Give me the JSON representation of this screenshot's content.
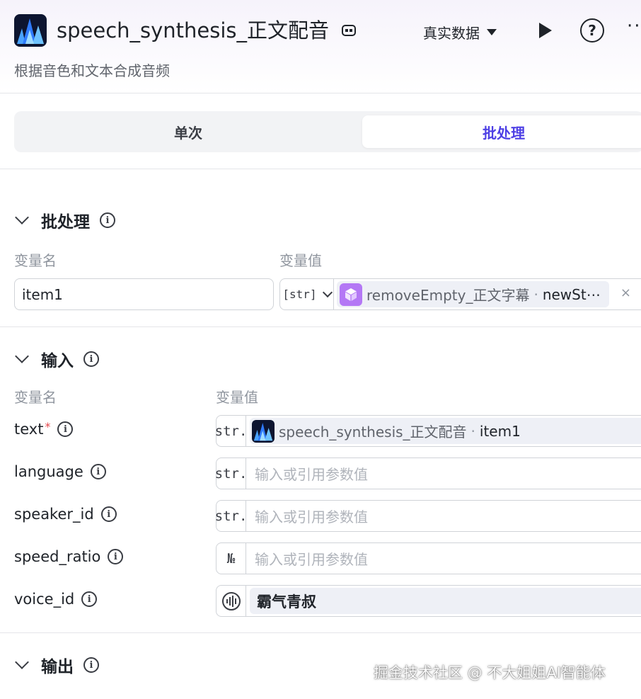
{
  "header": {
    "title": "speech_synthesis_正文配音",
    "subtitle": "根据音色和文本合成音频",
    "data_mode": "真实数据",
    "app_icon": "waveform-logo-icon",
    "copy_icon": "copy-id-icon",
    "play_icon": "play-icon",
    "help_icon": "question-icon",
    "help_glyph": "?",
    "more_glyph": "··",
    "accent_color": "#4e40e5"
  },
  "tabs": {
    "single": "单次",
    "batch": "批处理",
    "active": "batch"
  },
  "batch_section": {
    "title": "批处理",
    "col_name": "变量名",
    "col_value": "变量值",
    "var_name": "item1",
    "type_tag": "[str]",
    "ref_node": "removeEmpty_正文字幕",
    "ref_sep": "·",
    "ref_field": "newSt⋯",
    "clear": "×"
  },
  "input_section": {
    "title": "输入",
    "col_name": "变量名",
    "col_value": "变量值",
    "rows": [
      {
        "name": "text",
        "required": "*",
        "type": "str.",
        "ref_node": "speech_synthesis_正文配音",
        "ref_sep": "·",
        "ref_field": "item1"
      },
      {
        "name": "language",
        "type": "str.",
        "placeholder": "输入或引用参数值"
      },
      {
        "name": "speaker_id",
        "type": "str.",
        "placeholder": "输入或引用参数值"
      },
      {
        "name": "speed_ratio",
        "type": "№",
        "placeholder": "输入或引用参数值"
      },
      {
        "name": "voice_id",
        "type": "voice-icon",
        "value": "霸气青叔"
      }
    ]
  },
  "output_section": {
    "title": "输出"
  },
  "watermark": "掘金技术社区 @ 不大姐姐AI智能体"
}
